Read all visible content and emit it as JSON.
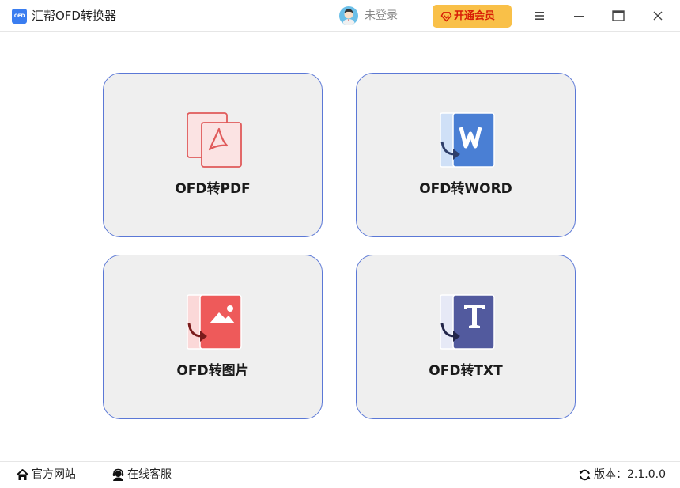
{
  "app": {
    "logo_text": "OFD",
    "title": "汇帮OFD转换器"
  },
  "header": {
    "user_status": "未登录",
    "vip_label": "开通会员",
    "accent_color": "#f9c048",
    "vip_text_color": "#d81e06"
  },
  "window_controls": {
    "menu_icon": "menu-icon",
    "minimize_icon": "minimize-icon",
    "maximize_icon": "maximize-icon",
    "close_icon": "close-icon"
  },
  "tools": [
    {
      "label": "OFD转PDF",
      "icon": "pdf-icon",
      "color": "#e05a5a"
    },
    {
      "label": "OFD转WORD",
      "icon": "word-icon",
      "color": "#4a7fd4"
    },
    {
      "label": "OFD转图片",
      "icon": "image-icon",
      "color": "#ee5a5a"
    },
    {
      "label": "OFD转TXT",
      "icon": "txt-icon",
      "color": "#525a9e"
    }
  ],
  "footer": {
    "website_label": "官方网站",
    "support_label": "在线客服",
    "version_label": "版本：2.1.0.0"
  }
}
